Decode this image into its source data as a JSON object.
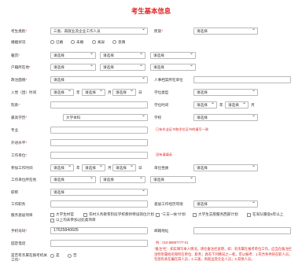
{
  "title": "考生基本信息",
  "fields": {
    "category": {
      "label": "考生类别",
      "value": "三类、再就业及企业工作人员"
    },
    "nation": {
      "label": "民族",
      "value": "请选择"
    },
    "marriage": {
      "label": "婚姻状况",
      "options": [
        "已婚",
        "未婚",
        "离异",
        "丧偶"
      ]
    },
    "native": {
      "label": "籍贯",
      "v1": "请选择",
      "v2": "请选择",
      "v3": "请选择"
    },
    "hukou": {
      "label": "户籍所在地",
      "v1": "请选择",
      "v2": "请选择",
      "v3": "请选择"
    },
    "political": {
      "label": "政治面貌",
      "value": "请选择"
    },
    "archive": {
      "label": "人事档案所在单位"
    },
    "join_date": {
      "label": "入党（团）时间",
      "year": "请选择",
      "year_unit": "年",
      "month": "请选择",
      "month_unit": "月",
      "day": "请选择",
      "day_unit": "日"
    },
    "degree": {
      "label": "学位类型",
      "value": "请选择"
    },
    "school": {
      "label": "院系"
    },
    "degree_date": {
      "label": "学位时间",
      "year": "请选择",
      "year_unit": "年",
      "month": "请选择",
      "month_unit": "月"
    },
    "edu": {
      "label": "最高学历",
      "value": "大学本科"
    },
    "edu_type": {
      "label": "学校",
      "value": "请选择"
    },
    "major": {
      "label": "专业"
    },
    "major_tip": "已有毕业证书和学位证书的填写一致",
    "other_major": {
      "label": "外语水平"
    },
    "work_unit": {
      "label": "工作单位"
    },
    "work_tip": "没有请填无",
    "work_date": {
      "label": "参加工作时间",
      "year": "请选择",
      "year_unit": "年",
      "month": "请选择",
      "month_unit": "月",
      "day": "请选择",
      "day_unit": "日"
    },
    "unit_type": {
      "label": "单位性质",
      "value": "请选择"
    },
    "work_loc": {
      "label": "工作单位所在地",
      "v1": "请选择",
      "v2": "请选择",
      "v3": "请选择"
    },
    "work_title": {
      "label": "职称",
      "value": "请选择"
    },
    "job": {
      "label": "工作职务"
    },
    "grass_years": {
      "label": "基层工作经历年限",
      "value": "请选择"
    },
    "project": {
      "label": "服务基层项目",
      "options": [
        "大学生村官",
        "农村义务教育阶段学校教师特设岗位计划",
        "\"三支一扶\"计划",
        "大学生志愿服务西部计划",
        "在军队服役5年以上",
        "以上均未参加过此类项目"
      ]
    },
    "phone": {
      "label": "手机号码",
      "value": "17625840605"
    },
    "email": {
      "label": "邮箱地址"
    },
    "fixed_phone": {
      "label": "固定电话"
    },
    "fixed_tip": "例：010-88887777-01",
    "related": {
      "label": "是否有亲属在报考机关工作",
      "options": [
        "是",
        "否"
      ]
    },
    "note": "\"备注\"栏：如实填写本人情况，请在备注栏说明，如：有亲属在报考单位工作，应当在备注栏注明亲属姓名和所在单位、职务；具有下列情况之一者，可以报考：1.符合条件的在职人员，包括有关在编在岗人员；2.三类、再就业及企业人员；3.其他人员。"
  }
}
